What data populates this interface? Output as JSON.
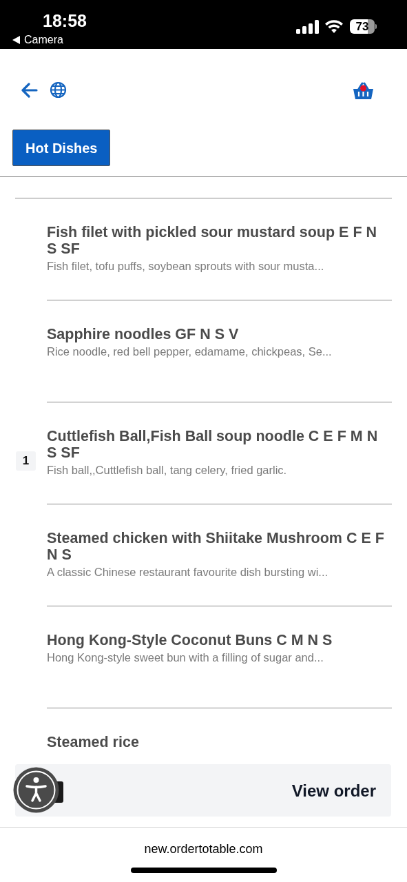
{
  "status_bar": {
    "time": "18:58",
    "back_label": "Camera",
    "battery": "73"
  },
  "tabs": [
    {
      "label": "Hot Dishes",
      "selected": true
    }
  ],
  "items": [
    {
      "title": "Fish filet with pickled sour mustard soup E F N S SF",
      "description": "Fish filet, tofu puffs, soybean sprouts with sour musta..."
    },
    {
      "title": "Sapphire noodles GF N S V",
      "description": "Rice noodle, red bell pepper, edamame, chickpeas, Se..."
    },
    {
      "title": "Cuttlefish Ball,Fish Ball soup noodle C E F M N S SF",
      "description": "Fish ball,,Cuttlefish ball, tang celery, fried garlic.",
      "quantity": "1"
    },
    {
      "title": "Steamed chicken with Shiitake Mushroom C E F N S",
      "description": "A classic Chinese restaurant favourite dish bursting wi..."
    },
    {
      "title": "Hong Kong-Style Coconut Buns C M N S",
      "description": "Hong Kong-style sweet bun with a filling of sugar and..."
    },
    {
      "title": "Steamed rice"
    }
  ],
  "order_bar": {
    "button": "View order"
  },
  "browser": {
    "url": "new.ordertotable.com"
  }
}
